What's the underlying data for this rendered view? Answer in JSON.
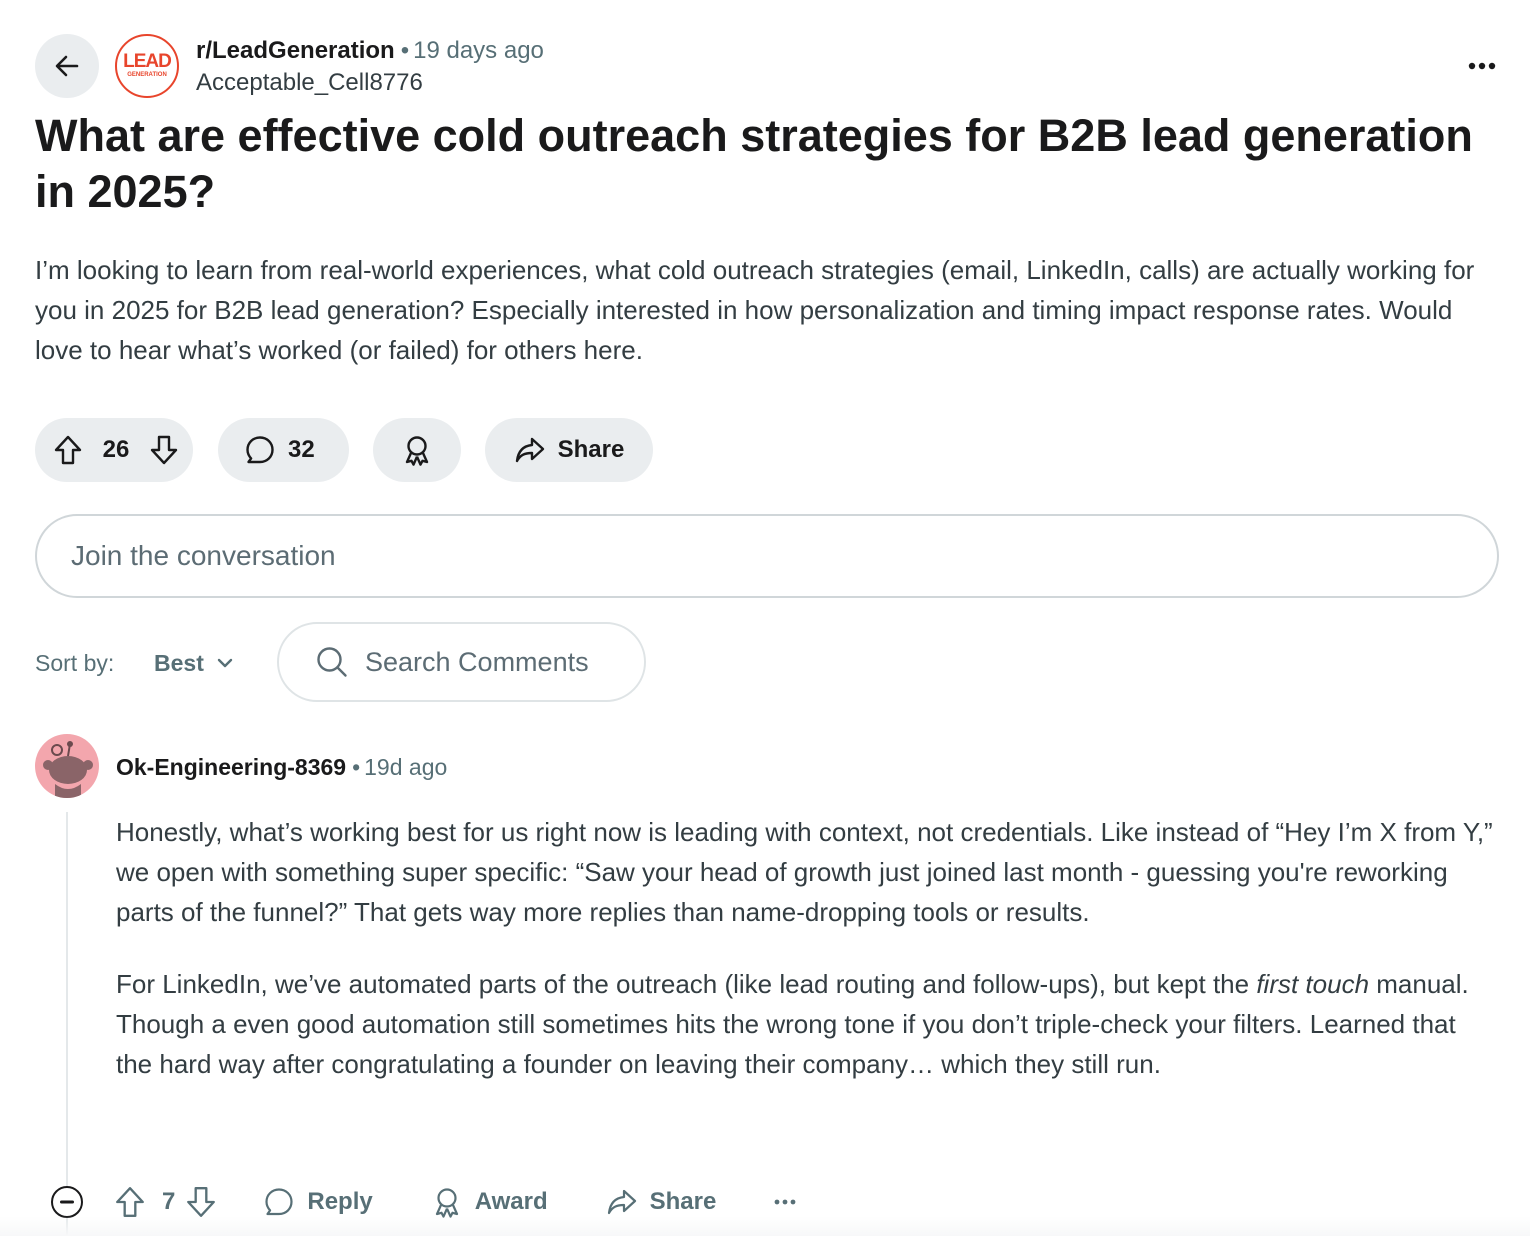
{
  "post": {
    "subreddit": "r/LeadGeneration",
    "separator": "•",
    "time_ago": "19 days ago",
    "author": "Acceptable_Cell8776",
    "subreddit_icon": {
      "line1": "LEAD",
      "line2": "GENERATION",
      "color": "#e8452c"
    },
    "title": "What are effective cold outreach strategies for B2B lead generation in 2025?",
    "body": "I’m looking to learn from real-world experiences, what cold outreach strategies (email, LinkedIn, calls) are actually working for you in 2025 for B2B lead generation? Especially interested in how personalization and timing impact response rates. Would love to hear what’s worked (or failed) for others here.",
    "upvotes": "26",
    "comments": "32",
    "share_label": "Share"
  },
  "compose": {
    "placeholder": "Join the conversation"
  },
  "sort": {
    "label": "Sort by:",
    "value": "Best"
  },
  "search": {
    "placeholder": "Search Comments"
  },
  "comment": {
    "author": "Ok-Engineering-8369",
    "separator": "•",
    "time_ago": "19d ago",
    "para1": "Honestly, what’s working best for us right now is leading with context, not credentials. Like instead of “Hey I’m X from Y,” we open with something super specific: “Saw your head of growth just joined last month - guessing you're reworking parts of the funnel?” That gets way more replies than name-dropping tools or results.",
    "para2_a": "For LinkedIn, we’ve automated parts of the outreach (like lead routing and follow-ups), but kept the ",
    "para2_em": "first touch",
    "para2_b": " manual. Though a even good automation still sometimes hits the wrong tone if you don’t triple-check your filters. Learned that the hard way after congratulating a founder on leaving their company… which they still run.",
    "upvotes": "7",
    "reply_label": "Reply",
    "award_label": "Award",
    "share_label": "Share"
  },
  "icons": {
    "back": "arrow-left-icon",
    "more": "ellipsis-icon",
    "upvote": "arrow-up-icon",
    "downvote": "arrow-down-icon",
    "comment": "speech-bubble-icon",
    "award": "award-ribbon-icon",
    "share": "share-arrow-icon",
    "search": "magnifier-icon",
    "collapse": "minus-circle-icon"
  }
}
